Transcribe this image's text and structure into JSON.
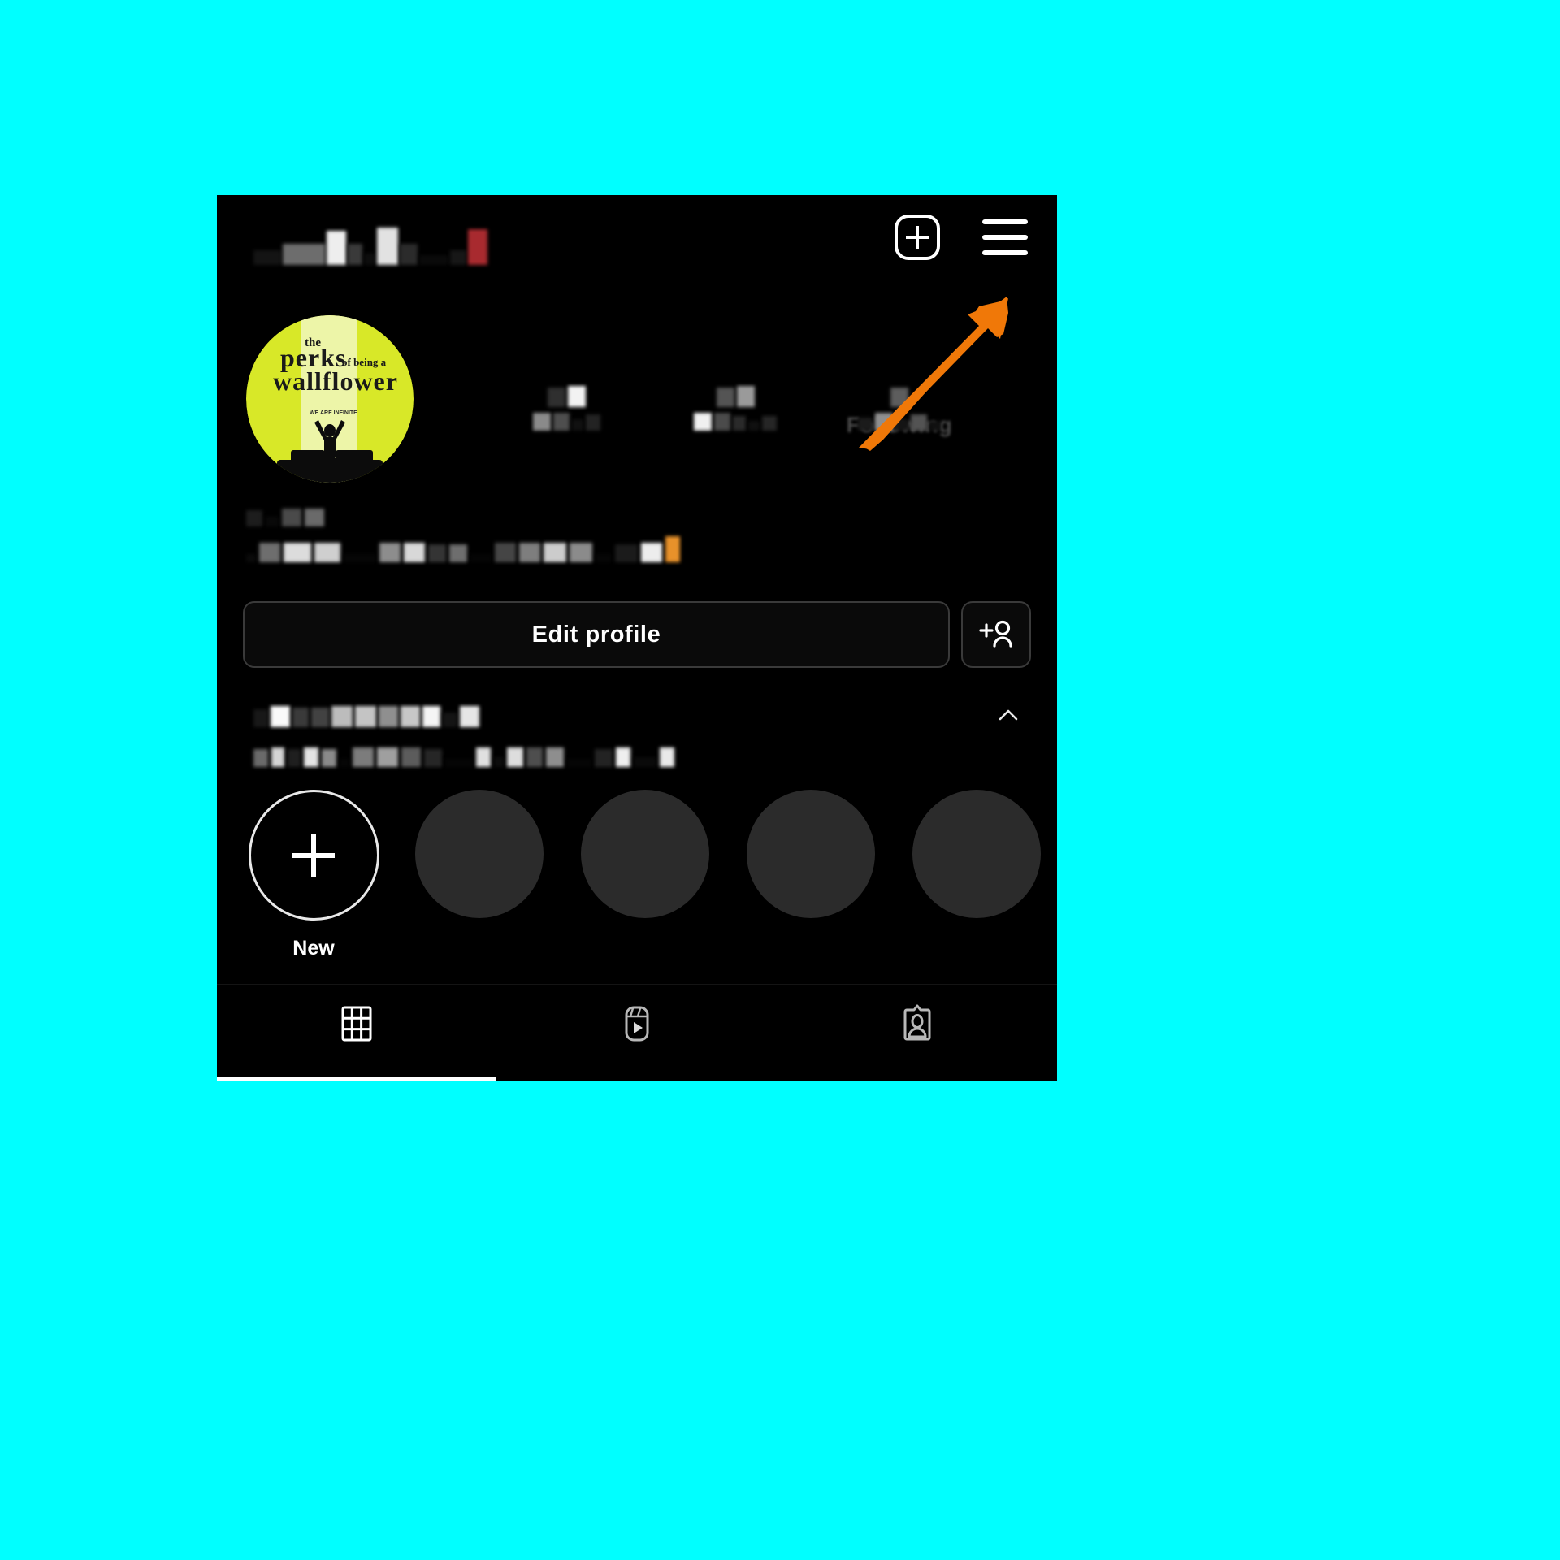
{
  "background_color": "#00FFFF",
  "app": {
    "name": "instagram-profile",
    "theme": "dark",
    "screen_background": "#000000"
  },
  "topbar": {
    "username_redacted": true,
    "username_placeholder": "",
    "add_post_icon": "plus-square-icon",
    "menu_icon": "hamburger-menu-icon"
  },
  "profile": {
    "avatar": {
      "icon": "profile-avatar",
      "description": "The Perks of Being a Wallflower movie poster",
      "title_line1": "the",
      "title_line2": "perks",
      "title_line3": "of being a",
      "title_line4": "wallflower",
      "tagline": "WE ARE INFINITE",
      "colors": {
        "background": "#D8E828",
        "highlight": "#EDF5A8",
        "text": "#1a1a1a"
      }
    },
    "stats": [
      {
        "name": "posts",
        "value_redacted": true,
        "label_redacted": true,
        "label_ghost": ""
      },
      {
        "name": "followers",
        "value_redacted": true,
        "label_redacted": true,
        "label_ghost": ""
      },
      {
        "name": "following",
        "value_redacted": true,
        "label_redacted": true,
        "label_ghost": "Following"
      }
    ],
    "bio_redacted": true,
    "bio_accent_color": "#E8912A"
  },
  "actions": {
    "edit_profile_label": "Edit profile",
    "add_person_icon": "add-person-icon"
  },
  "highlights": {
    "title_redacted": true,
    "subtitle_redacted": true,
    "collapse_icon": "chevron-up-icon",
    "new_label": "New",
    "new_icon": "plus-icon",
    "placeholder_count": 4,
    "placeholder_color": "#2b2b2b"
  },
  "tabbar": {
    "tabs": [
      {
        "name": "grid",
        "icon": "grid-icon",
        "active": true
      },
      {
        "name": "reels",
        "icon": "reels-icon",
        "active": false
      },
      {
        "name": "tagged",
        "icon": "tagged-icon",
        "active": false
      }
    ],
    "indicator_color": "#ffffff"
  },
  "annotation": {
    "arrow": {
      "name": "arrow-pointing-to-menu",
      "color": "#F07808",
      "direction": "up-right",
      "target": "hamburger-menu-icon"
    }
  }
}
